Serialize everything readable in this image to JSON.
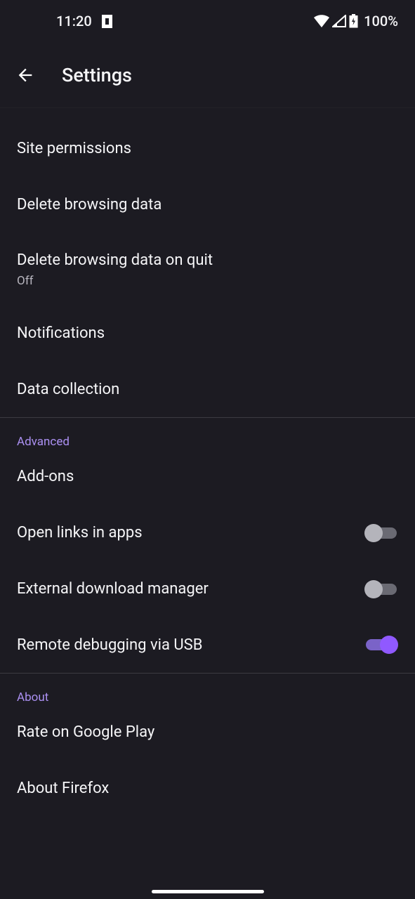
{
  "status": {
    "time": "11:20",
    "battery": "100%"
  },
  "header": {
    "title": "Settings"
  },
  "items": {
    "site_permissions": "Site permissions",
    "delete_browsing": "Delete browsing data",
    "delete_on_quit": "Delete browsing data on quit",
    "delete_on_quit_sub": "Off",
    "notifications": "Notifications",
    "data_collection": "Data collection",
    "addons": "Add-ons",
    "open_links": "Open links in apps",
    "ext_download": "External download manager",
    "remote_debug": "Remote debugging via USB",
    "rate": "Rate on Google Play",
    "about": "About Firefox"
  },
  "sections": {
    "advanced": "Advanced",
    "about": "About"
  },
  "toggles": {
    "open_links": false,
    "ext_download": false,
    "remote_debug": true
  }
}
